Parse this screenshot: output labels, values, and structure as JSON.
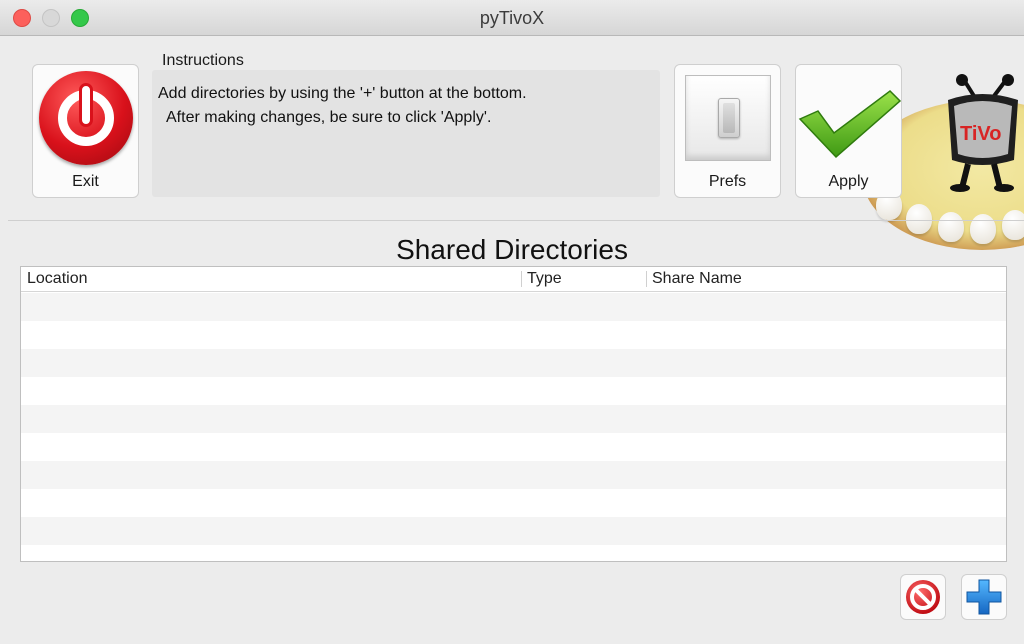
{
  "window": {
    "title": "pyTivoX"
  },
  "toolbar": {
    "exit_label": "Exit",
    "prefs_label": "Prefs",
    "apply_label": "Apply"
  },
  "instructions": {
    "label": "Instructions",
    "text": "Add directories by using the '+' button at the bottom.\n  After making changes, be sure to click 'Apply'."
  },
  "logo": {
    "text": "TiVo"
  },
  "shared": {
    "title": "Shared Directories",
    "columns": [
      "Location",
      "Type",
      "Share Name"
    ],
    "rows": []
  },
  "colors": {
    "close": "#fc605c",
    "zoom": "#34c84a",
    "exit_red": "#d9111b",
    "apply_green": "#6cc21f",
    "add_blue": "#1e8fe0"
  },
  "icons": {
    "exit": "power-icon",
    "prefs": "toggle-switch-icon",
    "apply": "checkmark-icon",
    "remove": "no-entry-icon",
    "add": "plus-icon"
  }
}
